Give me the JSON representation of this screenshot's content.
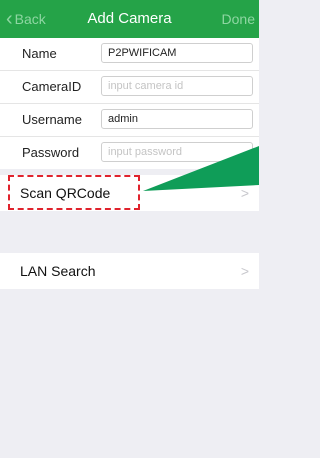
{
  "navbar": {
    "back_label": "Back",
    "title": "Add Camera",
    "done_label": "Done",
    "color": "#25a348"
  },
  "form": {
    "name": {
      "label": "Name",
      "value": "P2PWIFICAM",
      "placeholder": ""
    },
    "camera_id": {
      "label": "CameraID",
      "value": "",
      "placeholder": "input camera id"
    },
    "username": {
      "label": "Username",
      "value": "admin",
      "placeholder": ""
    },
    "password": {
      "label": "Password",
      "value": "",
      "placeholder": "input password"
    }
  },
  "actions": {
    "scan_qrcode": "Scan QRCode",
    "lan_search": "LAN Search",
    "arrow": ">"
  },
  "annotation": {
    "highlight_color": "#e0232d",
    "pointer_color": "#0f9d58"
  }
}
